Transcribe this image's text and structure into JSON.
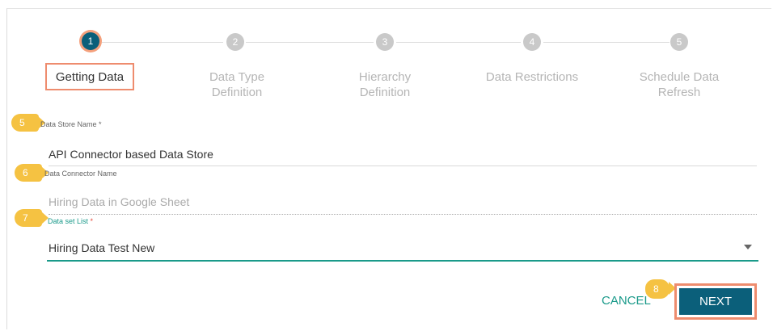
{
  "stepper": {
    "steps": [
      {
        "number": "1",
        "label_line1": "Getting Data",
        "label_line2": "",
        "state": "active"
      },
      {
        "number": "2",
        "label_line1": "Data Type",
        "label_line2": "Definition",
        "state": "inactive"
      },
      {
        "number": "3",
        "label_line1": "Hierarchy",
        "label_line2": "Definition",
        "state": "inactive"
      },
      {
        "number": "4",
        "label_line1": "Data Restrictions",
        "label_line2": "",
        "state": "inactive"
      },
      {
        "number": "5",
        "label_line1": "Schedule Data",
        "label_line2": "Refresh",
        "state": "inactive"
      }
    ]
  },
  "callouts": [
    "5",
    "6",
    "7",
    "8"
  ],
  "form": {
    "data_store_name": {
      "label": "Data Store Name",
      "required_mark": "*",
      "value": "API Connector based Data Store"
    },
    "data_connector_name": {
      "label": "Data Connector Name",
      "value": "Hiring Data in Google Sheet"
    },
    "data_set_list": {
      "label": "Data set List",
      "required_mark": "*",
      "selected": "Hiring Data Test New"
    }
  },
  "actions": {
    "cancel_label": "CANCEL",
    "next_label": "NEXT"
  },
  "colors": {
    "primary": "#0b5f7a",
    "accent": "#1a9a8a",
    "highlight": "#ee8c6e",
    "callout": "#f5c242",
    "required": "#e64a3b"
  }
}
